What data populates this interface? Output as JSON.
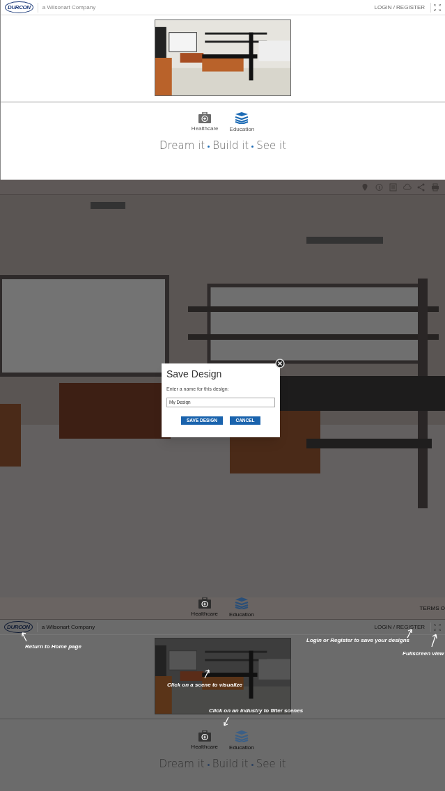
{
  "home": {
    "header": {
      "logo": "DURCON",
      "company": "a Wilsonart Company",
      "login": "LOGIN / REGISTER"
    },
    "industries": [
      {
        "label": "Healthcare",
        "kind": "healthcare",
        "selected": false
      },
      {
        "label": "Education",
        "kind": "education",
        "selected": true
      }
    ],
    "slogan": [
      "Dream it",
      "Build it",
      "See it"
    ]
  },
  "designer": {
    "dialog": {
      "title": "Save Design",
      "prompt": "Enter a name for this design:",
      "value": "My Design",
      "buttons": [
        "SAVE DESIGN",
        "CANCEL"
      ]
    },
    "industries": [
      {
        "label": "Healthcare",
        "kind": "healthcare",
        "selected": false
      },
      {
        "label": "Education",
        "kind": "education",
        "selected": true
      }
    ],
    "terms": "TERMS O"
  },
  "guide": {
    "header": {
      "logo": "DURCON",
      "company": "a Wilsonart Company",
      "login": "LOGIN / REGISTER"
    },
    "industries": [
      {
        "label": "Healthcare",
        "kind": "healthcare",
        "selected": false
      },
      {
        "label": "Education",
        "kind": "education",
        "selected": true
      }
    ],
    "slogan": [
      "Dream it",
      "Build it",
      "See it"
    ],
    "annotations": [
      {
        "kind": "home",
        "text": "Return to Home page"
      },
      {
        "kind": "login",
        "text": "Login or Register to save your designs"
      },
      {
        "kind": "fullscreen",
        "text": "Fullscreen view"
      },
      {
        "kind": "scene",
        "text": "Click on a scene to visualize"
      },
      {
        "kind": "industry",
        "text": "Click on an industry to filter scenes"
      }
    ]
  }
}
